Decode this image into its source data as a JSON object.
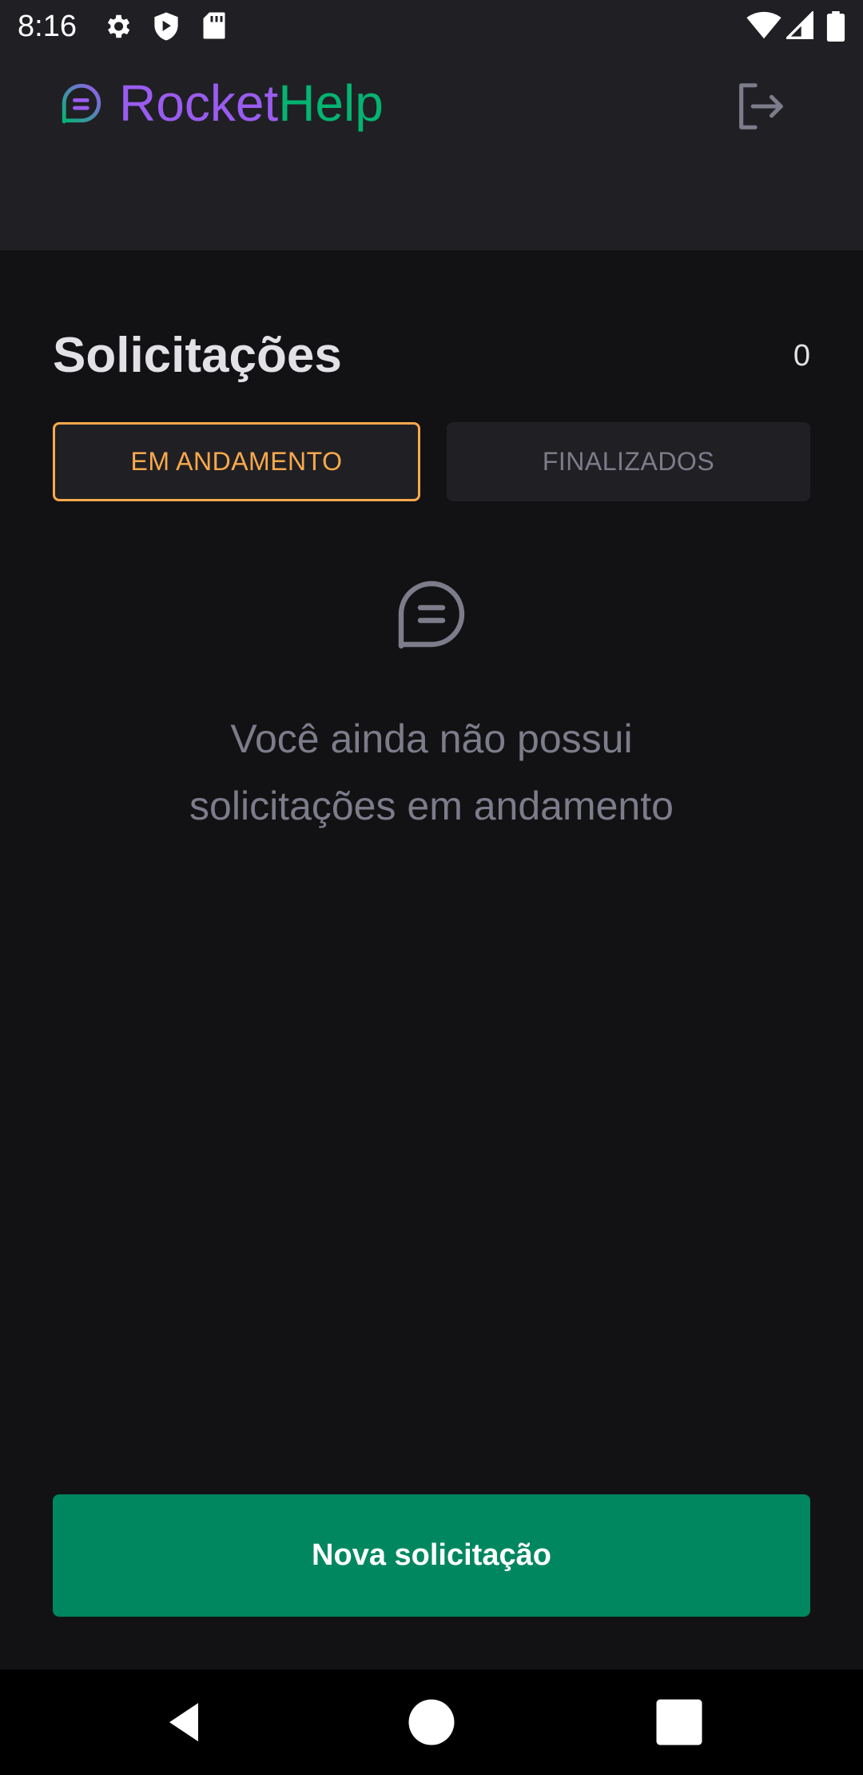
{
  "status_bar": {
    "time": "8:16",
    "icons": [
      "settings-icon",
      "play-protect-icon",
      "sd-card-icon",
      "wifi-icon",
      "signal-icon",
      "battery-icon"
    ]
  },
  "header": {
    "logo_part1": "Rocket",
    "logo_part2": "Help",
    "logo_icon": "chat-bubble-icon",
    "logout_icon": "sign-out-icon"
  },
  "main": {
    "title": "Solicitações",
    "count": "0",
    "tabs": [
      {
        "label": "EM ANDAMENTO",
        "active": true
      },
      {
        "label": "FINALIZADOS",
        "active": false
      }
    ],
    "empty_icon": "chat-bubble-icon",
    "empty_line1": "Você ainda não possui",
    "empty_line2": "solicitações em andamento"
  },
  "actions": {
    "new_request": "Nova solicitação"
  },
  "nav": {
    "back_icon": "back-icon",
    "home_icon": "home-icon",
    "recents_icon": "recents-icon"
  },
  "colors": {
    "background": "#121214",
    "header": "#202024",
    "purple": "#9a5cf0",
    "green": "#04b471",
    "button": "#00875f",
    "orange": "#fba94c",
    "gray": "#7c7c8a"
  }
}
